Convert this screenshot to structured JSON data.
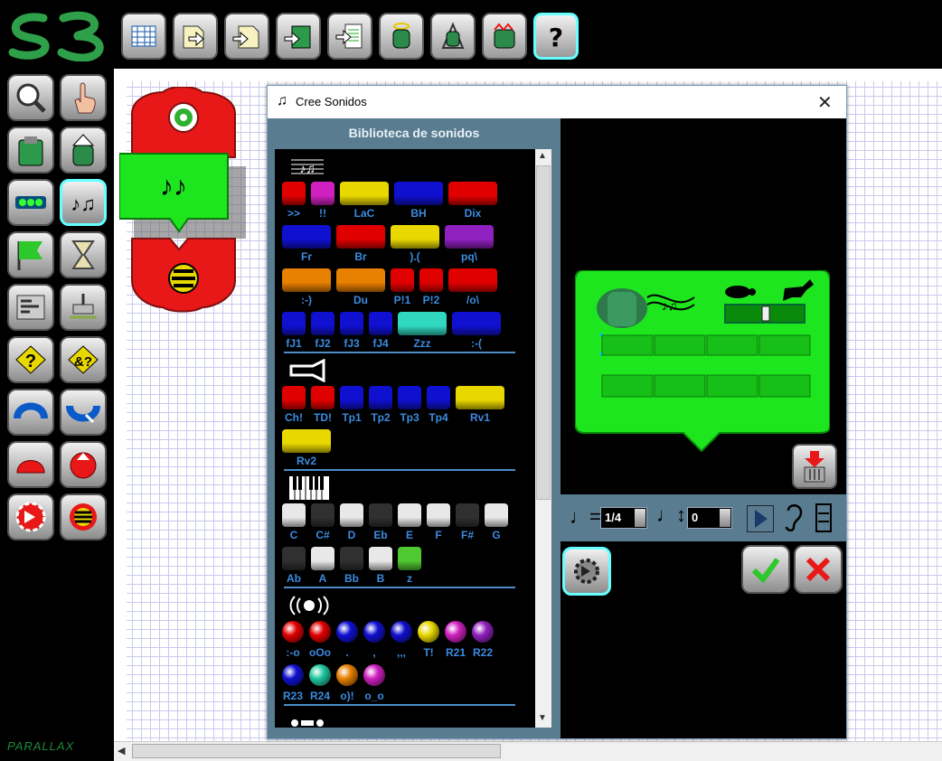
{
  "window": {
    "title": "Cree Sonidos"
  },
  "toolbar": {
    "buttons": [
      {
        "icon": "new-program-icon"
      },
      {
        "icon": "open-icon"
      },
      {
        "icon": "save-icon"
      },
      {
        "icon": "download-icon"
      },
      {
        "icon": "print-icon"
      },
      {
        "icon": "robot-info-icon"
      },
      {
        "icon": "robot-test-icon"
      },
      {
        "icon": "robot-run-icon"
      },
      {
        "icon": "help-icon"
      }
    ]
  },
  "brand": {
    "logo": "S3",
    "footer": "PARALLAX"
  },
  "library": {
    "title": "Biblioteca de sonidos",
    "sections": [
      {
        "icon": "sheet-music-icon",
        "rows": [
          [
            {
              "label": ">>",
              "color": "#e00000"
            },
            {
              "label": "!!",
              "color": "#d020c0"
            },
            {
              "label": "LaC",
              "color": "#e8d800"
            },
            {
              "label": "BH",
              "color": "#1010d0"
            },
            {
              "label": "Dix",
              "color": "#e00000"
            }
          ],
          [
            {
              "label": "Fr",
              "color": "#1010d0"
            },
            {
              "label": "Br",
              "color": "#e00000"
            },
            {
              "label": ").(",
              "color": "#e8d800"
            },
            {
              "label": "pq\\",
              "color": "#9020c0"
            }
          ],
          [
            {
              "label": ":-)",
              "color": "#e88000"
            },
            {
              "label": "Du",
              "color": "#e88000"
            },
            {
              "label": "P!1",
              "color": "#e00000"
            },
            {
              "label": "P!2",
              "color": "#e00000"
            },
            {
              "label": "/o\\",
              "color": "#e00000"
            }
          ],
          [
            {
              "label": "fJ1",
              "color": "#1010d0"
            },
            {
              "label": "fJ2",
              "color": "#1010d0"
            },
            {
              "label": "fJ3",
              "color": "#1010d0"
            },
            {
              "label": "fJ4",
              "color": "#1010d0"
            },
            {
              "label": "Zzz",
              "color": "#30d8c0"
            },
            {
              "label": ":-(",
              "color": "#1010d0"
            }
          ]
        ]
      },
      {
        "icon": "horn-icon",
        "rows": [
          [
            {
              "label": "Ch!",
              "color": "#e00000"
            },
            {
              "label": "TD!",
              "color": "#e00000"
            },
            {
              "label": "Tp1",
              "color": "#1010d0"
            },
            {
              "label": "Tp2",
              "color": "#1010d0"
            },
            {
              "label": "Tp3",
              "color": "#1010d0"
            },
            {
              "label": "Tp4",
              "color": "#1010d0"
            },
            {
              "label": "Rv1",
              "color": "#e8d800"
            }
          ],
          [
            {
              "label": "Rv2",
              "color": "#e8d800"
            }
          ]
        ]
      },
      {
        "icon": "piano-keys-icon",
        "rows": [
          [
            {
              "label": "C",
              "color": "#e8e8e8"
            },
            {
              "label": "C#",
              "color": "#303030"
            },
            {
              "label": "D",
              "color": "#e8e8e8"
            },
            {
              "label": "Eb",
              "color": "#303030"
            },
            {
              "label": "E",
              "color": "#e8e8e8"
            },
            {
              "label": "F",
              "color": "#e8e8e8"
            },
            {
              "label": "F#",
              "color": "#303030"
            },
            {
              "label": "G",
              "color": "#e8e8e8"
            }
          ],
          [
            {
              "label": "Ab",
              "color": "#303030"
            },
            {
              "label": "A",
              "color": "#e8e8e8"
            },
            {
              "label": "Bb",
              "color": "#303030"
            },
            {
              "label": "B",
              "color": "#e8e8e8"
            },
            {
              "label": "z",
              "color": "#50c830"
            }
          ]
        ]
      },
      {
        "icon": "sound-wave-icon",
        "rows": [
          [
            {
              "label": ":-o",
              "color": "#e00000"
            },
            {
              "label": "oOo",
              "color": "#e00000"
            },
            {
              "label": ".",
              "color": "#1010d0"
            },
            {
              "label": ",",
              "color": "#1010d0"
            },
            {
              "label": ",,,",
              "color": "#1010d0"
            },
            {
              "label": "T!",
              "color": "#e8d800"
            },
            {
              "label": "R21",
              "color": "#d020c0"
            },
            {
              "label": "R22",
              "color": "#9020c0"
            }
          ],
          [
            {
              "label": "R23",
              "color": "#1010d0"
            },
            {
              "label": "R24",
              "color": "#20c8a0"
            },
            {
              "label": "o)!",
              "color": "#e88000"
            },
            {
              "label": "o_o",
              "color": "#d020c0"
            }
          ]
        ]
      },
      {
        "icon": "morse-icon",
        "rows": [
          [
            {
              "label": "",
              "color": "#e8d800"
            },
            {
              "label": "",
              "color": "#1010d0"
            },
            {
              "label": "",
              "color": "#1010d0"
            },
            {
              "label": "",
              "color": "#1010d0"
            },
            {
              "label": "",
              "color": "#e8d800"
            },
            {
              "label": "",
              "color": "#1010d0"
            },
            {
              "label": "",
              "color": "#1010d0"
            },
            {
              "label": "",
              "color": "#1010d0"
            }
          ]
        ]
      }
    ]
  },
  "editor": {
    "duration": {
      "value": "1/4",
      "icon": "quarter-note-icon"
    },
    "transpose": {
      "value": "0",
      "icon": "note-updown-icon"
    },
    "play_icon": "play-icon",
    "listen_icon": "ear-icon",
    "slow_icon": "turtle-icon",
    "fast_icon": "horse-icon",
    "tempo_fraction": 0.5
  },
  "colors": {
    "accent": "#66ffff",
    "block_green": "#1ee61e",
    "block_red": "#e81818",
    "library_bg": "#5a7c90"
  }
}
